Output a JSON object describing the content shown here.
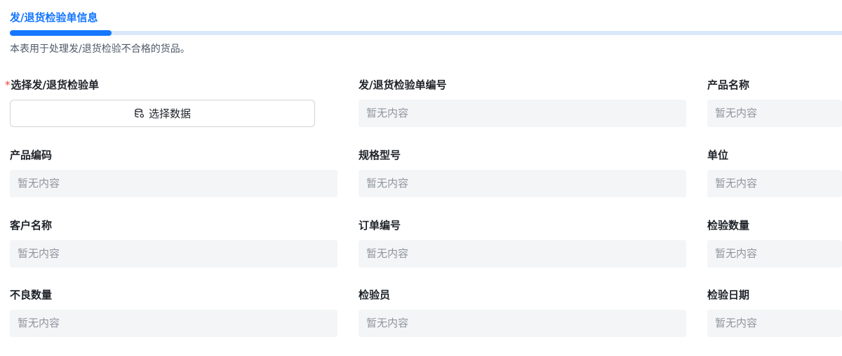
{
  "section": {
    "tab_title": "发/退货检验单信息",
    "description": "本表用于处理发/退货检验不合格的货品。"
  },
  "form": {
    "select_order": {
      "label": "选择发/退货检验单",
      "required_mark": "*",
      "button_label": "选择数据",
      "button_icon": "database-icon"
    },
    "placeholder": "暂无内容",
    "fields": [
      {
        "label": "发/退货检验单编号",
        "value": "暂无内容"
      },
      {
        "label": "产品名称",
        "value": "暂无内容"
      },
      {
        "label": "产品编码",
        "value": "暂无内容"
      },
      {
        "label": "规格型号",
        "value": "暂无内容"
      },
      {
        "label": "单位",
        "value": "暂无内容"
      },
      {
        "label": "客户名称",
        "value": "暂无内容"
      },
      {
        "label": "订单编号",
        "value": "暂无内容"
      },
      {
        "label": "检验数量",
        "value": "暂无内容"
      },
      {
        "label": "不良数量",
        "value": "暂无内容"
      },
      {
        "label": "检验员",
        "value": "暂无内容"
      },
      {
        "label": "检验日期",
        "value": "暂无内容"
      }
    ]
  },
  "colors": {
    "accent": "#1677ff",
    "required": "#f53f3f",
    "field_background": "#f4f5f7",
    "placeholder_text": "#8f959e"
  }
}
